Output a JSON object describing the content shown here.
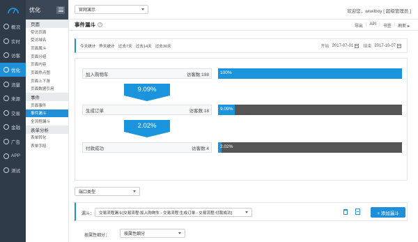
{
  "rail": {
    "items": [
      {
        "label": "概况",
        "icon": "overview-icon"
      },
      {
        "label": "实时",
        "icon": "clock-icon"
      },
      {
        "label": "访客",
        "icon": "visitor-icon"
      },
      {
        "label": "优化",
        "icon": "optimize-icon"
      },
      {
        "label": "流量",
        "icon": "traffic-icon"
      },
      {
        "label": "来源",
        "icon": "source-icon"
      },
      {
        "label": "交易",
        "icon": "trade-icon"
      },
      {
        "label": "金融",
        "icon": "finance-icon"
      },
      {
        "label": "广告",
        "icon": "ad-icon"
      },
      {
        "label": "APP",
        "icon": "app-icon"
      },
      {
        "label": "测试",
        "icon": "test-icon"
      }
    ],
    "active_index": 3
  },
  "sub": {
    "title": "优化",
    "groups": [
      {
        "label": "页面",
        "items": [
          "受访页面",
          "受访域名",
          "页面属斗",
          "页面分组",
          "页面内容",
          "页面热点图",
          "页面上下游",
          "页面数据引用"
        ]
      },
      {
        "label": "事件",
        "items": [
          "页面事件",
          "事件漏斗",
          "全流程漏斗"
        ]
      },
      {
        "label": "表单分析",
        "items": [
          "表单转化",
          "表单字段"
        ]
      }
    ],
    "active_item": "事件漏斗"
  },
  "topbar": {
    "site": "官网演示",
    "welcome": "欢迎您，wiwilboy [ 超级管理员 ]"
  },
  "page": {
    "title": "事件漏斗",
    "actions": [
      "导出",
      "API",
      "书签",
      "刷新 ▸"
    ]
  },
  "datebar": {
    "tabs": [
      "今天统计",
      "昨天统计",
      "过去7天",
      "过去14天",
      "过去30天"
    ],
    "start_label": "开始",
    "start_date": "2017-07-01",
    "end_label": "结束",
    "end_date": "2017-10-07"
  },
  "funnel": {
    "steps": [
      {
        "name": "加入购物车",
        "visitors": "访客数:198",
        "percent": "100%",
        "fill": 100
      },
      {
        "name": "生成订单",
        "visitors": "访客数:18",
        "percent": "9.09%",
        "fill": 9.09
      },
      {
        "name": "付款成功",
        "visitors": "访客数:4",
        "percent": "2.02%",
        "fill": 2.02
      }
    ],
    "conversions": [
      "9.09%",
      "2.02%"
    ],
    "colors": {
      "bar": "#1a94dc",
      "track": "#555555"
    }
  },
  "dimension": {
    "value": "端口类型"
  },
  "config": {
    "label": "漏斗：",
    "value": "交易流程漏斗[交易流程:加入购物车 - 交易流程:生成订单 - 交易流程:付款成功]",
    "add_button": "+ 添加漏斗"
  },
  "filter": {
    "label": "按属性细分：",
    "value": "按属性细分"
  }
}
